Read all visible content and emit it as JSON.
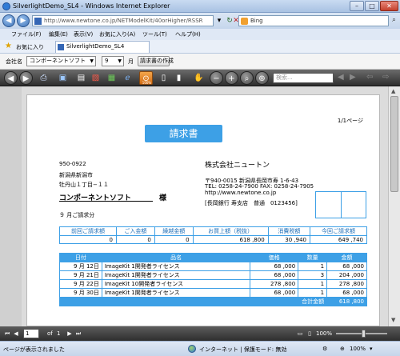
{
  "window": {
    "title": "SilverlightDemo_SL4 - Windows Internet Explorer",
    "min": "–",
    "max": "□",
    "close": "✕"
  },
  "address": {
    "url": "http://www.newtone.co.jp/NETModelKit/40orHigher/RSSR",
    "search_placeholder": "Bing",
    "refresh": "↻",
    "stop": "✕",
    "compat": "▾"
  },
  "menu": [
    "ファイル(F)",
    "編集(E)",
    "表示(V)",
    "お気に入り(A)",
    "ツール(T)",
    "ヘルプ(H)"
  ],
  "favorites": {
    "label": "お気に入り",
    "tab": "SilverlightDemo_SL4"
  },
  "app": {
    "company_label": "会社名",
    "company_value": "コンポーネントソフト",
    "month_value": "9",
    "month_label": "月",
    "create_button": "請求書の作成"
  },
  "viewer": {
    "zoom_label": "100%",
    "search_placeholder": "検索..."
  },
  "invoice": {
    "page_indicator": "1/1ページ",
    "title": "請求書",
    "postal": "950-0922",
    "addr1": "新潟県新潟市",
    "addr2": "牡丹山１丁目−１１",
    "customer": "コンポーネントソフト",
    "honorific": "様",
    "period": "９ 月ご請求分",
    "company": "株式会社ニュートン",
    "company_addr": "〒940-0015 新潟県長岡市寿 1-6-43",
    "company_tel": "TEL: 0258-24-7900 FAX: 0258-24-7905",
    "company_url": "http://www.newtone.co.jp",
    "bank": "[長岡銀行 寿支店　普通　0123456]",
    "summary": {
      "headers": [
        "前回ご請求額",
        "ご入金額",
        "繰越金額",
        "お買上額（税抜）",
        "消費税額",
        "今回ご請求額"
      ],
      "values": [
        "0",
        "0",
        "0",
        "618 ,800",
        "30 ,940",
        "649 ,740"
      ]
    },
    "details": {
      "headers": [
        "日付",
        "品名",
        "価格",
        "数量",
        "金額"
      ],
      "rows": [
        [
          "9 月 12日",
          "ImageKit 1開発者ライセンス",
          "68 ,000",
          "1",
          "68 ,000"
        ],
        [
          "9 月 21日",
          "ImageKit 1開発者ライセンス",
          "68 ,000",
          "3",
          "204 ,000"
        ],
        [
          "9 月 22日",
          "ImageKit 10開発者ライセンス",
          "278 ,800",
          "1",
          "278 ,800"
        ],
        [
          "9 月 30日",
          "ImageKit 1開発者ライセンス",
          "68 ,000",
          "1",
          "68 ,000"
        ]
      ],
      "total_label": "合計金額",
      "total_value": "618 ,800"
    }
  },
  "pager": {
    "current": "1",
    "of_label": "of",
    "total": "1",
    "zoom": "100%"
  },
  "status": {
    "message": "ページが表示されました",
    "zone": "インターネット | 保護モード: 無効",
    "zoom": "100%"
  }
}
